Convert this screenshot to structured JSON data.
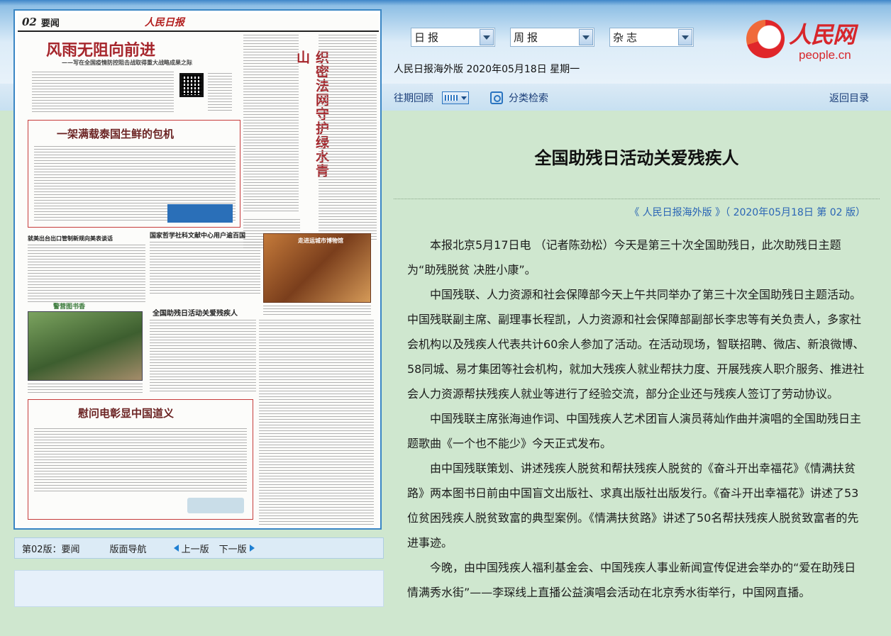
{
  "selects": [
    {
      "value": "日报"
    },
    {
      "value": "周报"
    },
    {
      "value": "杂志"
    }
  ],
  "logo": {
    "cn": "人民网",
    "en": "people.cn"
  },
  "edition_line": "人民日报海外版 2020年05月18日 星期一",
  "toolbar": {
    "past_review": "往期回顾",
    "category_search": "分类检索",
    "back": "返回目录"
  },
  "article": {
    "title": "全国助残日活动关爱残疾人",
    "source": "《 人民日报海外版 》（ 2020年05月18日   第 02 版）",
    "paragraphs": [
      "本报北京5月17日电 （记者陈劲松）今天是第三十次全国助残日，此次助残日主题为“助残脱贫 决胜小康”。",
      "中国残联、人力资源和社会保障部今天上午共同举办了第三十次全国助残日主题活动。中国残联副主席、副理事长程凯，人力资源和社会保障部副部长李忠等有关负责人，多家社会机构以及残疾人代表共计60余人参加了活动。在活动现场，智联招聘、微店、新浪微博、58同城、易才集团等社会机构，就加大残疾人就业帮扶力度、开展残疾人职介服务、推进社会人力资源帮扶残疾人就业等进行了经验交流，部分企业还与残疾人签订了劳动协议。",
      "中国残联主席张海迪作词、中国残疾人艺术团盲人演员蒋灿作曲并演唱的全国助残日主题歌曲《一个也不能少》今天正式发布。",
      "由中国残联策划、讲述残疾人脱贫和帮扶残疾人脱贫的《奋斗开出幸福花》《情满扶贫路》两本图书日前由中国盲文出版社、求真出版社出版发行。《奋斗开出幸福花》讲述了53位贫困残疾人脱贫致富的典型案例。《情满扶贫路》讲述了50名帮扶残疾人脱贫致富者的先进事迹。",
      "今晚，由中国残疾人福利基金会、中国残疾人事业新闻宣传促进会举办的“爱在助残日 情满秀水街”——李琛线上直播公益演唱会活动在北京秀水街举行，中国网直播。"
    ]
  },
  "page_nav": {
    "label": "第02版：要闻",
    "nav_title": "版面导航",
    "prev": "上一版",
    "next": "下一版"
  },
  "newspaper": {
    "page_no": "02",
    "section": "要闻",
    "masthead": "人民日报",
    "headline_main": "风雨无阻向前进",
    "headline_sub": "——写在全国疫情防控阻击战取得重大战略成果之际",
    "headline_vertical": "织密法网守护绿水青山",
    "headline_box1": "一架满载泰国生鲜的包机",
    "headline_small1": "就美出台出口管制新规向美表谈话",
    "headline_small2": "国家哲学社科文献中心用户逾百国",
    "headline_museum": "走进运城市博物馆",
    "headline_article": "全国助残日活动关爱残疾人",
    "headline_police": "警营图书香",
    "headline_box2": "慰问电彰显中国道义"
  }
}
